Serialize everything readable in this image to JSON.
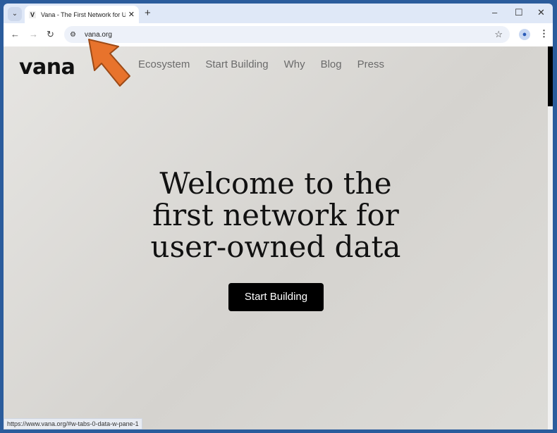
{
  "browser": {
    "tab_title": "Vana - The First Network for User-Owned Data",
    "favicon": "V",
    "url": "vana.org",
    "status_url": "https://www.vana.org/#w-tabs-0-data-w-pane-1"
  },
  "site": {
    "logo": "vana",
    "nav": [
      "Ecosystem",
      "Start Building",
      "Why",
      "Blog",
      "Press"
    ],
    "hero_lines": [
      "Welcome to the",
      "first network for",
      "user-owned data"
    ],
    "cta": "Start Building"
  },
  "colors": {
    "window_frame": "#2b5c9c",
    "cta_bg": "#000000",
    "annotation_arrow": "#e8732c"
  }
}
